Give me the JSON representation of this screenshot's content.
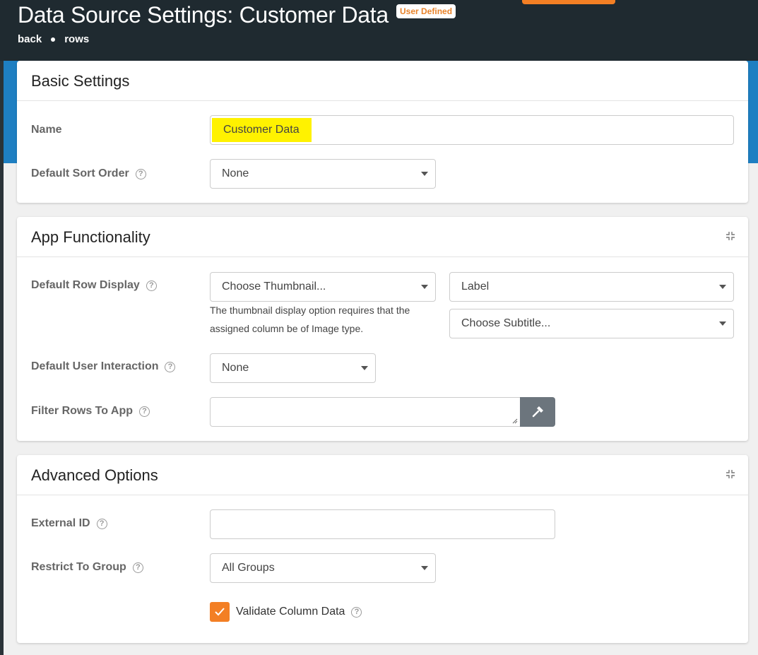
{
  "header": {
    "title": "Data Source Settings: Customer Data",
    "badge": "User Defined",
    "breadcrumb": [
      "back",
      "rows"
    ],
    "accent_color": "#f37f24",
    "bg_color": "#1f2a30",
    "band_color": "#1e7fc2"
  },
  "basic_settings": {
    "title": "Basic Settings",
    "name_label": "Name",
    "name_value": "Customer Data",
    "sort_label": "Default Sort Order",
    "sort_value": "None"
  },
  "app_functionality": {
    "title": "App Functionality",
    "row_display_label": "Default Row Display",
    "thumbnail_value": "Choose Thumbnail...",
    "thumbnail_hint": "The thumbnail display option requires that the assigned column be of Image type.",
    "label_value": "Label",
    "subtitle_value": "Choose Subtitle...",
    "interaction_label": "Default User Interaction",
    "interaction_value": "None",
    "filter_label": "Filter Rows To App",
    "filter_value": ""
  },
  "advanced_options": {
    "title": "Advanced Options",
    "external_id_label": "External ID",
    "external_id_value": "",
    "group_label": "Restrict To Group",
    "group_value": "All Groups",
    "validate_label": "Validate Column Data",
    "validate_checked": true
  },
  "icons": {
    "help": "help-circle-icon",
    "collapse": "collapse-icon",
    "filter_builder": "wrench-icon",
    "dropdown": "chevron-down-icon",
    "checkbox": "check-icon"
  }
}
